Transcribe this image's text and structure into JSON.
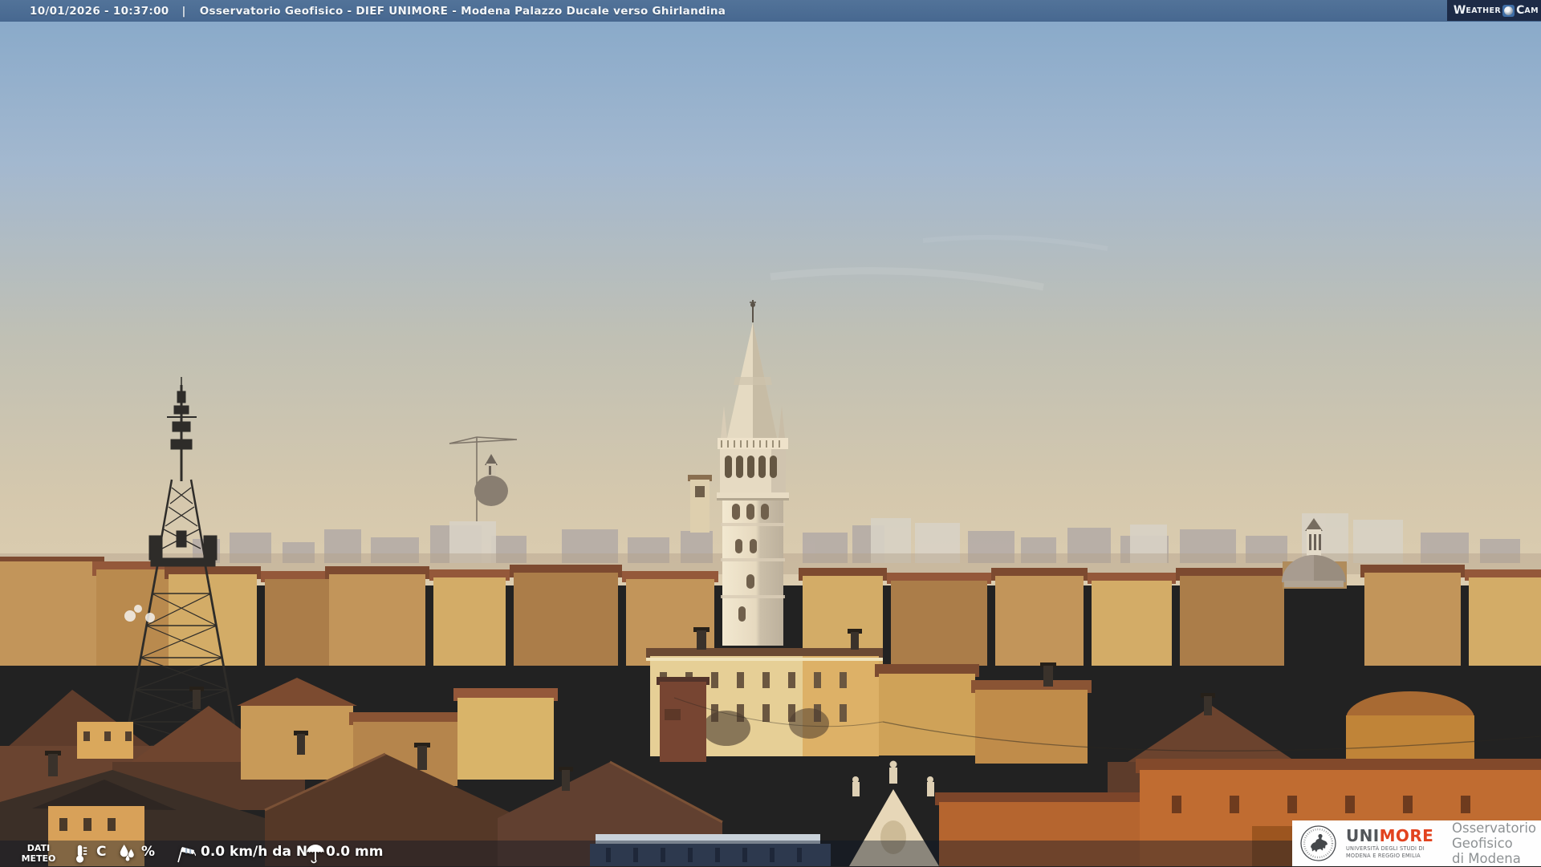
{
  "header": {
    "timestamp": "10/01/2026 - 10:37:00",
    "separator": "|",
    "title": "Osservatorio Geofisico - DIEF UNIMORE - Modena Palazzo Ducale verso Ghirlandina",
    "logo": {
      "w": "W",
      "eather": "EATHER",
      "c": "C",
      "am": "AM"
    }
  },
  "weather_bar": {
    "label_line1": "DATI",
    "label_line2": "METEO",
    "temperature": {
      "value": "",
      "unit": "C",
      "icon": "thermometer-icon"
    },
    "humidity": {
      "value": "",
      "unit": "%",
      "icon": "droplets-icon"
    },
    "wind": {
      "value": "0.0 km/h da N",
      "icon": "windsock-icon"
    },
    "rain": {
      "value": "0.0 mm",
      "icon": "umbrella-icon"
    }
  },
  "footer_logo": {
    "brand_uni": "UNI",
    "brand_more": "MORE",
    "subtitle_line1": "UNIVERSITÀ DEGLI STUDI DI",
    "subtitle_line2": "MODENA E REGGIO EMILIA",
    "right_line1": "Osservatorio Geofisico",
    "right_line2": "di Modena"
  },
  "colors": {
    "header_bar": "#4d6f96",
    "weathercam_bg": "#1d2b47",
    "unimore_red": "#e2431f",
    "logo_text_gray": "#8e9294",
    "sky_top": "#88a9c8",
    "sky_horizon": "#dccdb0"
  }
}
